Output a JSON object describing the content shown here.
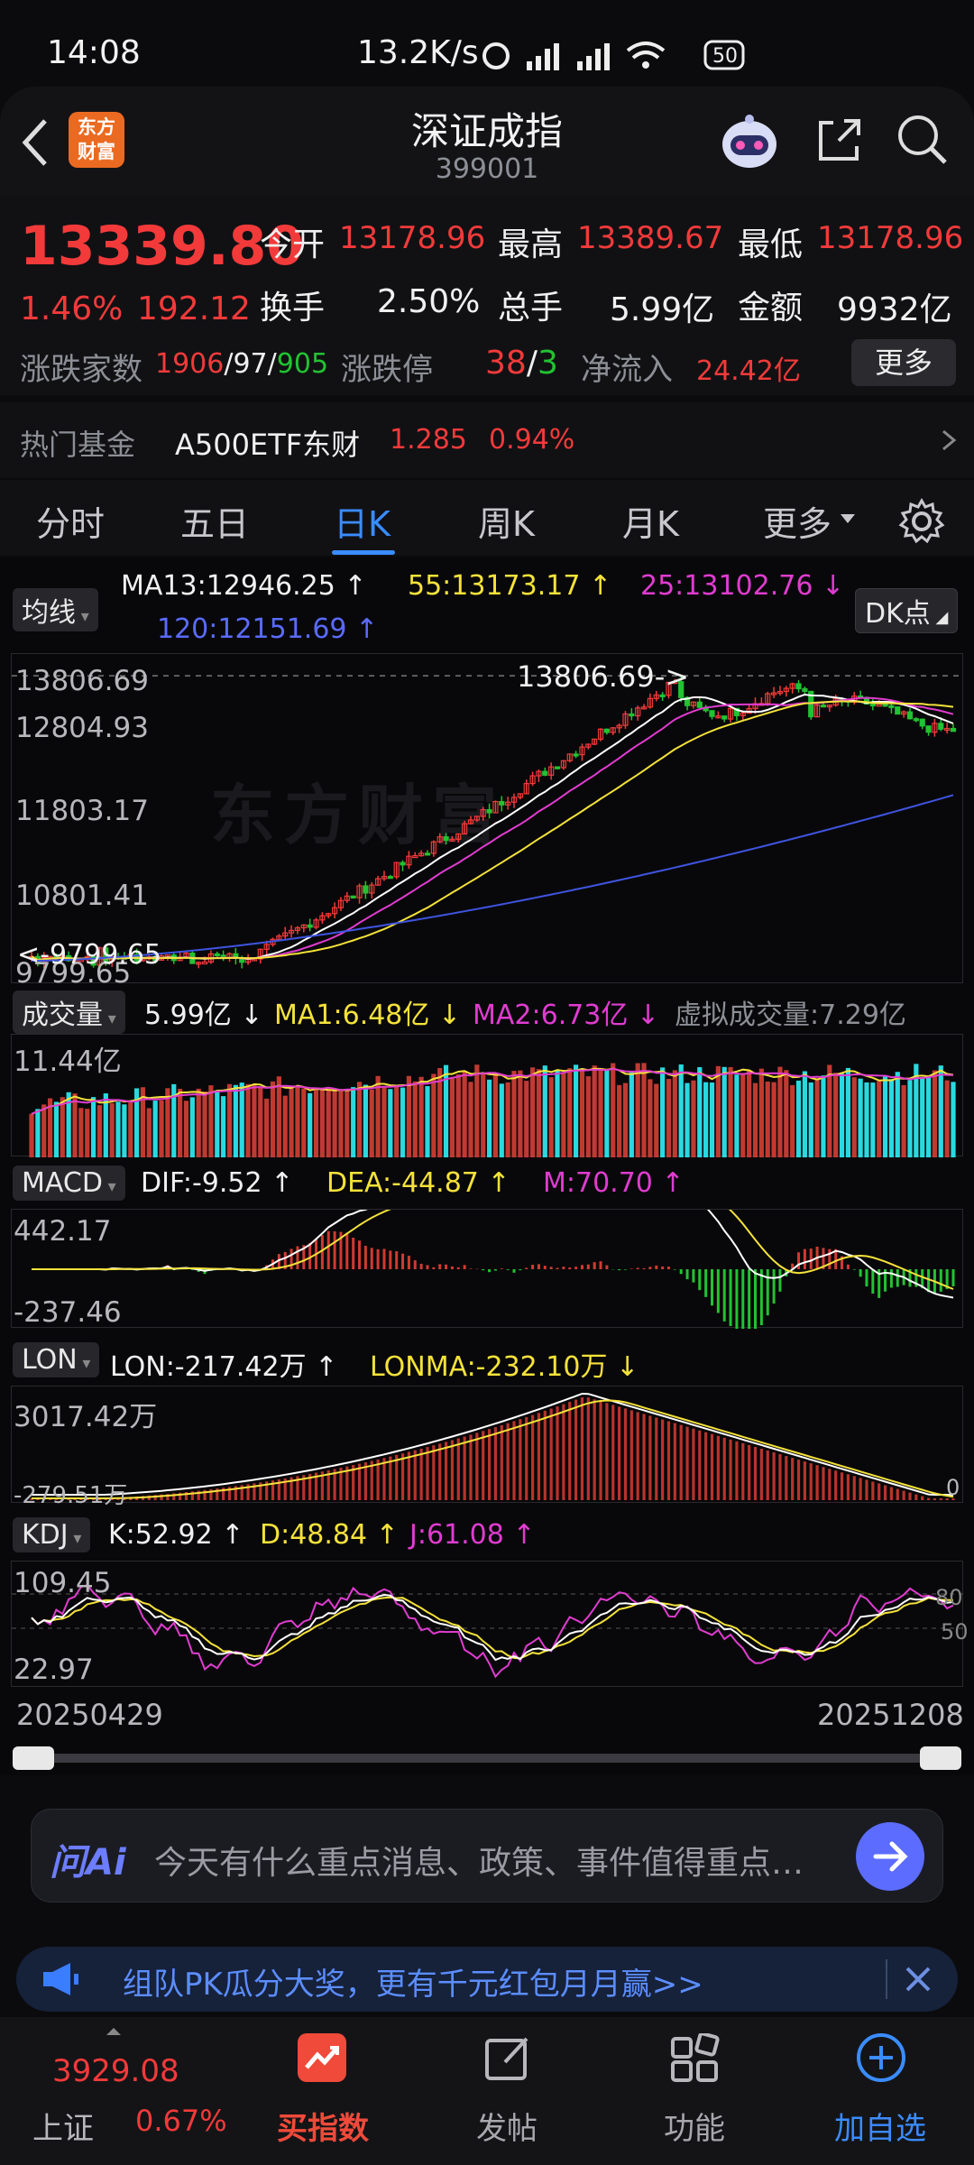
{
  "status": {
    "time": "14:08",
    "speed": "13.2K/s",
    "battery": "50"
  },
  "header": {
    "logo": "东方财富",
    "title": "深证成指",
    "code": "399001"
  },
  "quote": {
    "price": "13339.80",
    "pct": "1.46%",
    "chg": "192.12",
    "open_label": "今开",
    "open": "13178.96",
    "high_label": "最高",
    "high": "13389.67",
    "low_label": "最低",
    "low": "13178.96",
    "turnover_label": "换手",
    "turnover": "2.50%",
    "volume_label": "总手",
    "volume": "5.99亿",
    "amount_label": "金额",
    "amount": "9932亿",
    "updown_label": "涨跌家数",
    "up": "1906",
    "flat": "97",
    "down": "905",
    "limit_label": "涨跌停",
    "limit_up": "38",
    "limit_down": "3",
    "netflow_label": "净流入",
    "netflow": "24.42亿",
    "more_button": "更多"
  },
  "fund": {
    "label": "热门基金",
    "name": "A500ETF东财",
    "price": "1.285",
    "pct": "0.94%"
  },
  "tabs": [
    "分时",
    "五日",
    "日K",
    "周K",
    "月K",
    "更多"
  ],
  "kline": {
    "ma_select": "均线",
    "ma13": "MA13:12946.25 ↑",
    "ma55": "55:13173.17 ↑",
    "ma25": "25:13102.76 ↓",
    "ma120": "120:12151.69 ↑",
    "dk": "DK点",
    "axis": [
      "13806.69",
      "12804.93",
      "11803.17",
      "10801.41",
      "9799.65"
    ],
    "max_marker": "13806.69->",
    "min_marker": "<-9799.65",
    "watermark": "东方财富"
  },
  "vol": {
    "select": "成交量",
    "value": "5.99亿 ↓",
    "ma1": "MA1:6.48亿 ↓",
    "ma2": "MA2:6.73亿 ↓",
    "virtual": "虚拟成交量:7.29亿",
    "axis": "11.44亿"
  },
  "macd": {
    "select": "MACD",
    "dif": "DIF:-9.52 ↑",
    "dea": "DEA:-44.87 ↑",
    "m": "M:70.70 ↑",
    "axis_top": "442.17",
    "axis_bot": "-237.46"
  },
  "lon": {
    "select": "LON",
    "lon": "LON:-217.42万 ↑",
    "lonma": "LONMA:-232.10万 ↓",
    "axis_top": "3017.42万",
    "axis_bot": "-279.51万",
    "zero": "0"
  },
  "kdj": {
    "select": "KDJ",
    "k": "K:52.92 ↑",
    "d": "D:48.84 ↑",
    "j": "J:61.08 ↑",
    "axis_top": "109.45",
    "axis_bot": "22.97",
    "r80": "80",
    "r50": "50"
  },
  "dates": {
    "start": "20250429",
    "end": "20251208"
  },
  "ask": {
    "brand": "问Ai",
    "placeholder": "今天有什么重点消息、政策、事件值得重点…"
  },
  "promo": {
    "text": "组队PK瓜分大奖，更有千元红包月月赢>>"
  },
  "nav": {
    "index_name": "上证",
    "index_value": "3929.08",
    "index_pct": "0.67%",
    "items": [
      "买指数",
      "发帖",
      "功能",
      "加自选"
    ]
  },
  "colors": {
    "up": "#f23a3a",
    "down": "#22c232",
    "accent": "#3a8cff",
    "ma13": "#ffffff",
    "ma55": "#f5e23a",
    "ma25": "#e03cd0",
    "ma120": "#3f54e0"
  }
}
